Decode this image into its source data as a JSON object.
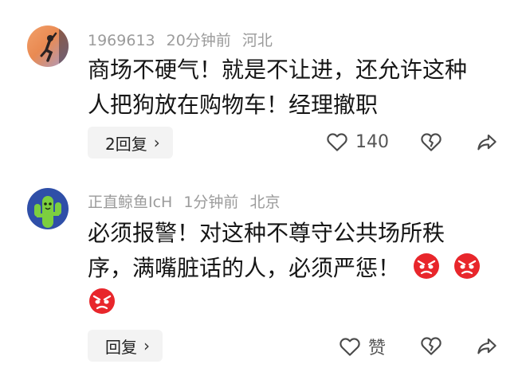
{
  "comments": [
    {
      "username": "1969613",
      "time": "20分钟前",
      "location": "河北",
      "lines": [
        "商场不硬气！就是不让进，还允许这种",
        "人把狗放在购物车！经理撤职"
      ],
      "reply_label": "2回复",
      "like_label": "140"
    },
    {
      "username": "正直鲸鱼IcH",
      "time": "1分钟前",
      "location": "北京",
      "lines": [
        "必须报警！对这种不尊守公共场所秩",
        "序，满嘴脏话的人，必须严惩！"
      ],
      "reply_label": "回复",
      "like_label": "赞"
    }
  ],
  "icons": {
    "reply_chevron": "›",
    "like": "heart-outline-icon",
    "dislike": "broken-heart-icon",
    "share": "share-arrow-icon",
    "emoji": "angry-face-emoji"
  },
  "colors": {
    "meta_text": "#9b9b9b",
    "body_text": "#161616",
    "reply_bg": "#f3f3f3",
    "emoji_red": "#e8262b",
    "avatar2_bg": "#2f4fa8",
    "avatar2_cactus": "#7ccf3f"
  }
}
